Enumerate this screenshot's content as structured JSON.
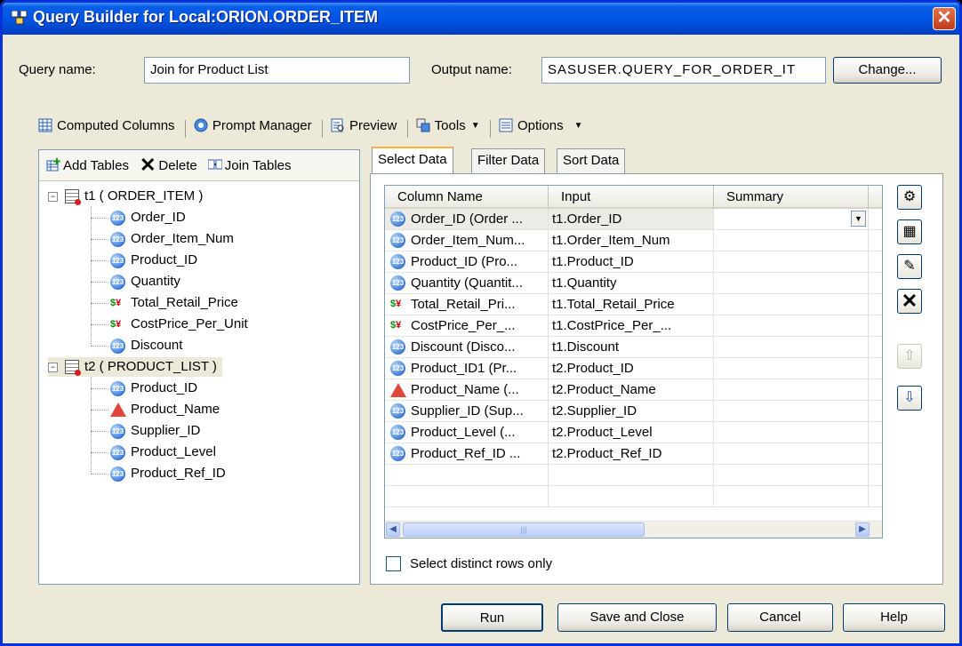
{
  "window": {
    "title": "Query Builder for Local:ORION.ORDER_ITEM",
    "close_glyph": "✕"
  },
  "form": {
    "query_name_label": "Query name:",
    "query_name_value": "Join for Product List",
    "output_name_label": "Output name:",
    "output_name_value": "SASUSER.QUERY_FOR_ORDER_IT",
    "change_button": "Change..."
  },
  "toolbar": {
    "computed_columns": "Computed Columns",
    "prompt_manager": "Prompt Manager",
    "preview": "Preview",
    "tools": "Tools",
    "options": "Options"
  },
  "left_panel": {
    "add_tables": "Add Tables",
    "delete": "Delete",
    "join_tables": "Join Tables",
    "tables": [
      {
        "label": "t1 ( ORDER_ITEM )",
        "columns": [
          {
            "name": "Order_ID",
            "icon": "numeric-icon"
          },
          {
            "name": "Order_Item_Num",
            "icon": "numeric-icon"
          },
          {
            "name": "Product_ID",
            "icon": "numeric-icon"
          },
          {
            "name": "Quantity",
            "icon": "numeric-icon"
          },
          {
            "name": "Total_Retail_Price",
            "icon": "currency-icon"
          },
          {
            "name": "CostPrice_Per_Unit",
            "icon": "currency-icon"
          },
          {
            "name": "Discount",
            "icon": "numeric-icon"
          }
        ]
      },
      {
        "label": "t2 ( PRODUCT_LIST )",
        "columns": [
          {
            "name": "Product_ID",
            "icon": "numeric-icon"
          },
          {
            "name": "Product_Name",
            "icon": "character-icon"
          },
          {
            "name": "Supplier_ID",
            "icon": "numeric-icon"
          },
          {
            "name": "Product_Level",
            "icon": "numeric-icon"
          },
          {
            "name": "Product_Ref_ID",
            "icon": "numeric-icon"
          }
        ]
      }
    ]
  },
  "tabs": [
    "Select Data",
    "Filter Data",
    "Sort Data"
  ],
  "grid": {
    "headers": [
      "Column Name",
      "Input",
      "Summary"
    ],
    "rows": [
      {
        "icon": "numeric-icon",
        "column": "Order_ID (Order ...",
        "input": "t1.Order_ID"
      },
      {
        "icon": "numeric-icon",
        "column": "Order_Item_Num...",
        "input": "t1.Order_Item_Num"
      },
      {
        "icon": "numeric-icon",
        "column": "Product_ID (Pro...",
        "input": "t1.Product_ID"
      },
      {
        "icon": "numeric-icon",
        "column": "Quantity (Quantit...",
        "input": "t1.Quantity"
      },
      {
        "icon": "currency-icon",
        "column": "Total_Retail_Pri...",
        "input": "t1.Total_Retail_Price"
      },
      {
        "icon": "currency-icon",
        "column": "CostPrice_Per_...",
        "input": "t1.CostPrice_Per_..."
      },
      {
        "icon": "numeric-icon",
        "column": "Discount (Disco...",
        "input": "t1.Discount"
      },
      {
        "icon": "numeric-icon",
        "column": "Product_ID1 (Pr...",
        "input": "t2.Product_ID"
      },
      {
        "icon": "character-icon",
        "column": "Product_Name (...",
        "input": "t2.Product_Name"
      },
      {
        "icon": "numeric-icon",
        "column": "Supplier_ID (Sup...",
        "input": "t2.Supplier_ID"
      },
      {
        "icon": "numeric-icon",
        "column": "Product_Level (...",
        "input": "t2.Product_Level"
      },
      {
        "icon": "numeric-icon",
        "column": "Product_Ref_ID ...",
        "input": "t2.Product_Ref_ID"
      }
    ],
    "icon_text": {
      "numeric": "123",
      "currency_dollar": "$",
      "currency_yen": "¥"
    }
  },
  "distinct_label": "Select distinct rows only",
  "buttons": {
    "run": "Run",
    "save_close": "Save and Close",
    "cancel": "Cancel",
    "help": "Help"
  },
  "colors": {
    "title_bar": "#0055e5",
    "dialog": "#ece9d8",
    "selection_tab": "#f7b23c"
  }
}
